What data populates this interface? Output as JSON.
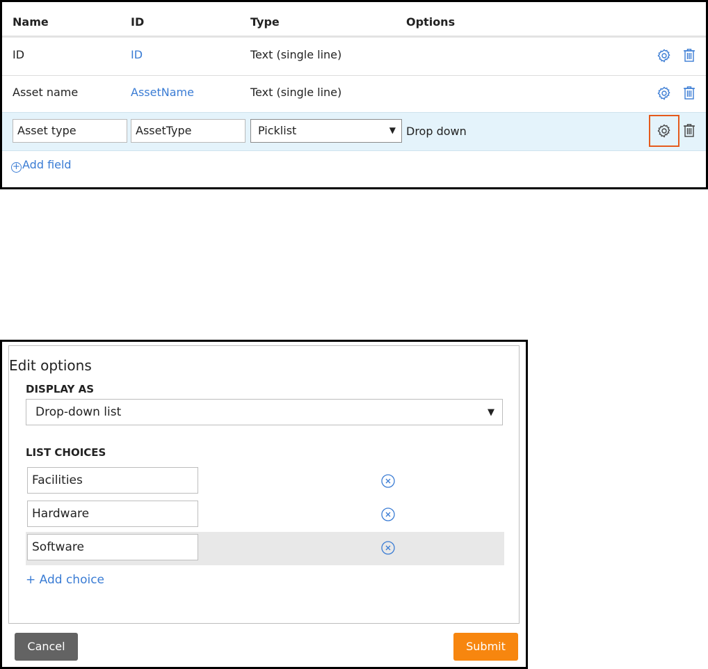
{
  "fields_table": {
    "headers": {
      "name": "Name",
      "id": "ID",
      "type": "Type",
      "options": "Options"
    },
    "rows": [
      {
        "name": "ID",
        "id": "ID",
        "type": "Text (single line)",
        "options": ""
      },
      {
        "name": "Asset name",
        "id": "AssetName",
        "type": "Text (single line)",
        "options": ""
      },
      {
        "name": "Asset type",
        "id": "AssetType",
        "type": "Picklist",
        "options": "Drop down"
      }
    ],
    "add_field_label": "Add field",
    "icons": {
      "settings": "gear-icon",
      "delete": "trash-icon",
      "add": "plus-circle-icon"
    },
    "colors": {
      "link": "#3a7cd4",
      "highlight": "#e55a1c",
      "editing_row": "#e4f3fb"
    }
  },
  "edit_options": {
    "title": "Edit options",
    "display_as_label": "DISPLAY AS",
    "display_as_value": "Drop-down list",
    "list_choices_label": "LIST CHOICES",
    "choices": [
      "Facilities",
      "Hardware",
      "Software"
    ],
    "add_choice_label": "+ Add choice",
    "cancel_label": "Cancel",
    "submit_label": "Submit",
    "colors": {
      "submit": "#f7860f",
      "cancel": "#636363"
    }
  }
}
